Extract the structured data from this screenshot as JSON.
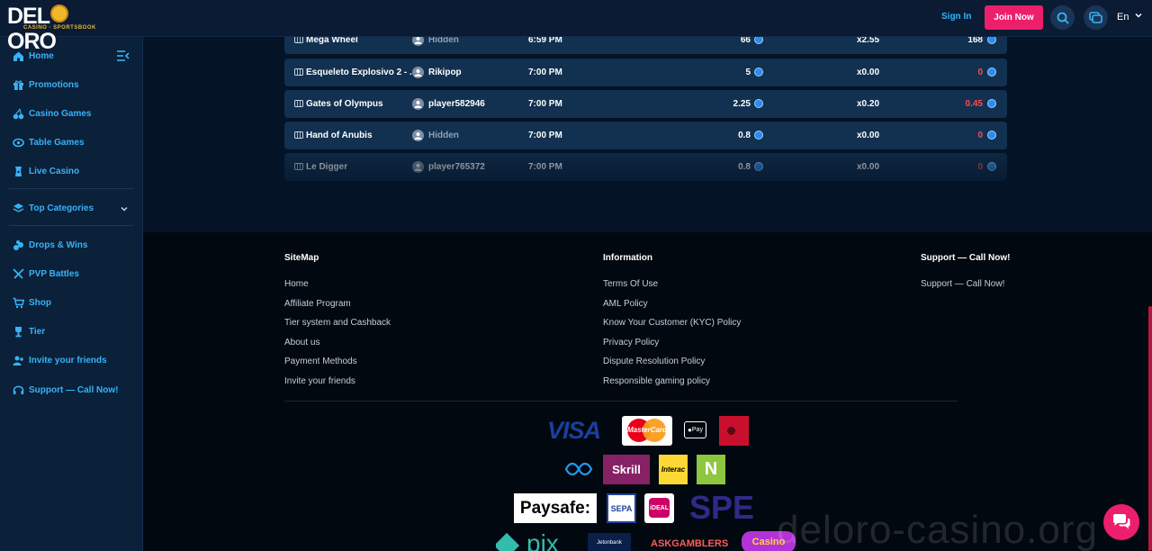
{
  "brand": {
    "name_left": "DEL",
    "name_right": "ORO",
    "sub": "CASINO · SPORTSBOOK"
  },
  "header": {
    "sign_in": "Sign In",
    "join_now": "Join Now",
    "language": "En"
  },
  "sidebar": {
    "items": [
      {
        "label": "Home",
        "icon": "home-icon"
      },
      {
        "label": "Promotions",
        "icon": "gift-icon"
      },
      {
        "label": "Casino Games",
        "icon": "cherries-icon"
      },
      {
        "label": "Table Games",
        "icon": "table-games-icon"
      },
      {
        "label": "Live Casino",
        "icon": "live-casino-icon"
      },
      {
        "label": "Top Categories",
        "icon": "layers-icon"
      },
      {
        "label": "Drops & Wins",
        "icon": "drops-icon"
      },
      {
        "label": "PVP Battles",
        "icon": "swords-icon"
      },
      {
        "label": "Shop",
        "icon": "cart-icon"
      },
      {
        "label": "Tier",
        "icon": "trophy-icon"
      },
      {
        "label": "Invite your friends",
        "icon": "users-icon"
      },
      {
        "label": "Support — Call Now!",
        "icon": "headset-icon"
      }
    ]
  },
  "bets": [
    {
      "game": "Mega Wheel",
      "player": "Hidden",
      "time": "6:59 PM",
      "bet": "66",
      "multiplier": "x2.55",
      "payout": "168",
      "payout_color": "#ffffff",
      "player_color": "#8fa2b8"
    },
    {
      "game": "Esqueleto Explosivo 2 - ...",
      "player": "Rikipop",
      "time": "7:00 PM",
      "bet": "5",
      "multiplier": "x0.00",
      "payout": "0",
      "payout_color": "#ff4b4b",
      "player_color": "#ffffff"
    },
    {
      "game": "Gates of Olympus",
      "player": "player582946",
      "time": "7:00 PM",
      "bet": "2.25",
      "multiplier": "x0.20",
      "payout": "0.45",
      "payout_color": "#ff4b4b",
      "player_color": "#ffffff"
    },
    {
      "game": "Hand of Anubis",
      "player": "Hidden",
      "time": "7:00 PM",
      "bet": "0.8",
      "multiplier": "x0.00",
      "payout": "0",
      "payout_color": "#ff4b4b",
      "player_color": "#8fa2b8"
    },
    {
      "game": "Le Digger",
      "player": "player765372",
      "time": "7:00 PM",
      "bet": "0.8",
      "multiplier": "x0.00",
      "payout": "0",
      "payout_color": "#ff4b4b",
      "player_color": "#ffffff"
    }
  ],
  "footer": {
    "sitemap": {
      "title": "SiteMap",
      "links": [
        "Home",
        "Affiliate Program",
        "Tier system and Cashback",
        "About us",
        "Payment Methods",
        "Invite your friends"
      ]
    },
    "information": {
      "title": "Information",
      "links": [
        "Terms Of Use",
        "AML Policy",
        "Know Your Customer (KYC) Policy",
        "Privacy Policy",
        "Dispute Resolution Policy",
        "Responsible gaming policy"
      ]
    },
    "support": {
      "title": "Support — Call Now!",
      "links": [
        "Support — Call Now!"
      ]
    },
    "payments": {
      "visa": "VISA",
      "mastercard": "MasterCard",
      "applepay": "Pay",
      "skrill": "Skrill",
      "interac": "Interac",
      "neteller": "N",
      "paysafe": "Paysafe:",
      "sepa": "SEPA",
      "ideal": "iDEAL",
      "spei": "SPE",
      "pix": "pix",
      "jeton": "Jetonbank",
      "askgamblers": "ASKGAMBLERS",
      "casino_guru": "Casino"
    },
    "watermark": "deloro-casino.org"
  },
  "colors": {
    "accent": "#37b3f7",
    "join": "#ec1f6d",
    "loss": "#ff4b4b",
    "bg": "#041325"
  }
}
